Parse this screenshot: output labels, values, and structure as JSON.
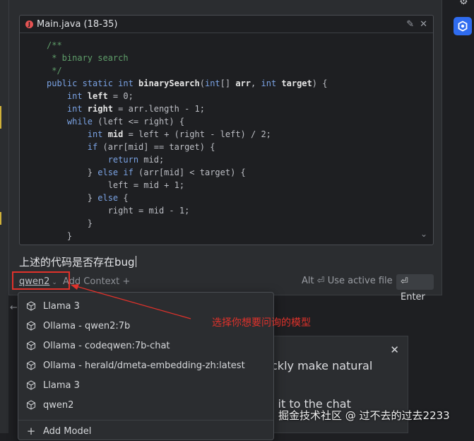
{
  "code_card": {
    "file_label": "Main.java (18-35)",
    "lines": [
      [
        [
          "tok-comment",
          "/**"
        ]
      ],
      [
        [
          "tok-comment",
          " * binary search"
        ]
      ],
      [
        [
          "tok-comment",
          " */"
        ]
      ],
      [
        [
          "tok-kw",
          "public static int "
        ],
        [
          "tok-fn",
          "binarySearch"
        ],
        [
          "tok-plain",
          "("
        ],
        [
          "tok-kw",
          "int"
        ],
        [
          "tok-plain",
          "[] "
        ],
        [
          "tok-fn",
          "arr"
        ],
        [
          "tok-plain",
          ", "
        ],
        [
          "tok-kw",
          "int "
        ],
        [
          "tok-fn",
          "target"
        ],
        [
          "tok-plain",
          ") {"
        ]
      ],
      [
        [
          "tok-kw",
          "    int "
        ],
        [
          "tok-fn",
          "left"
        ],
        [
          "tok-plain",
          " = 0;"
        ]
      ],
      [
        [
          "tok-kw",
          "    int "
        ],
        [
          "tok-fn",
          "right"
        ],
        [
          "tok-plain",
          " = arr.length - 1;"
        ]
      ],
      [
        [
          "tok-kw",
          "    while "
        ],
        [
          "tok-plain",
          "(left <= right) {"
        ]
      ],
      [
        [
          "tok-kw",
          "        int "
        ],
        [
          "tok-fn",
          "mid"
        ],
        [
          "tok-plain",
          " = left + (right - left) / 2;"
        ]
      ],
      [
        [
          "tok-kw",
          "        if "
        ],
        [
          "tok-plain",
          "(arr[mid] == target) {"
        ]
      ],
      [
        [
          "tok-kw",
          "            return "
        ],
        [
          "tok-plain",
          "mid;"
        ]
      ],
      [
        [
          "tok-plain",
          "        } "
        ],
        [
          "tok-kw",
          "else if "
        ],
        [
          "tok-plain",
          "(arr[mid] < target) {"
        ]
      ],
      [
        [
          "tok-plain",
          "            left = mid + 1;"
        ]
      ],
      [
        [
          "tok-plain",
          "        } "
        ],
        [
          "tok-kw",
          "else "
        ],
        [
          "tok-plain",
          "{"
        ]
      ],
      [
        [
          "tok-plain",
          "            right = mid - 1;"
        ]
      ],
      [
        [
          "tok-plain",
          "        }"
        ]
      ],
      [
        [
          "tok-plain",
          "    }"
        ]
      ]
    ]
  },
  "prompt_text": "上述的代码是否存在bug",
  "toolbar": {
    "model_selected": "qwen2",
    "add_context": "Add Context +",
    "use_active_file": "Alt ⏎ Use active file",
    "enter": "⏎ Enter"
  },
  "annotation": "选择你想要问询的模型",
  "dropdown": {
    "items": [
      "Llama 3",
      "Ollama - qwen2:7b",
      "Ollama - codeqwen:7b-chat",
      "Ollama - herald/dmeta-embedding-zh:latest",
      "Llama 3",
      "qwen2"
    ],
    "add_model": "Add Model"
  },
  "tip_card": {
    "line1": "ckly make natural",
    "line2": "l it to the chat"
  },
  "watermark": "掘金技术社区 @ 过不去的过去2233",
  "colors": {
    "annotation_red": "#e0322b",
    "plugin_blue": "#2f6cf0",
    "java_red": "#e55353"
  }
}
